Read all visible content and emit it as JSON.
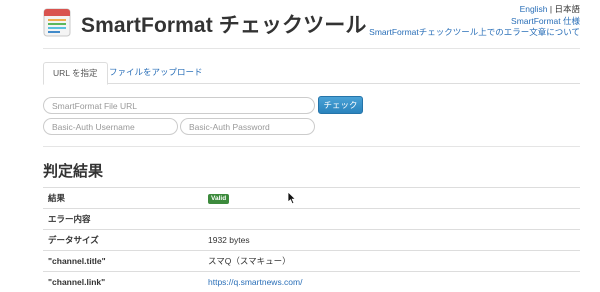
{
  "header": {
    "app_title": "SmartFormat チェックツール",
    "lang_english": "English",
    "lang_separator": "|",
    "lang_japanese": "日本語",
    "spec_link": "SmartFormat 仕様",
    "about_link": "SmartFormatチェックツール上でのエラー文章について"
  },
  "tabs": [
    {
      "label": "URL を指定",
      "active": true
    },
    {
      "label": "ファイルをアップロード",
      "active": false
    }
  ],
  "form": {
    "url_placeholder": "SmartFormat File URL",
    "user_placeholder": "Basic-Auth Username",
    "pass_placeholder": "Basic-Auth Password",
    "check_button": "チェック"
  },
  "results": {
    "heading": "判定結果",
    "rows": [
      {
        "key": "結果",
        "value": "Valid",
        "badge": true
      },
      {
        "key": "エラー内容",
        "value": ""
      },
      {
        "key": "データサイズ",
        "value": "1932 bytes"
      },
      {
        "key": "\"channel.title\"",
        "value": "スマQ（スマキュー）"
      },
      {
        "key": "\"channel.link\"",
        "value": "https://q.smartnews.com/",
        "link": true
      }
    ]
  },
  "colors": {
    "accent": "#2a6fb8",
    "button": "#2a83bd",
    "valid_badge": "#3c8a3c"
  },
  "icons": {
    "logo": "smartformat-logo-icon",
    "cursor": "mouse-pointer-icon"
  }
}
